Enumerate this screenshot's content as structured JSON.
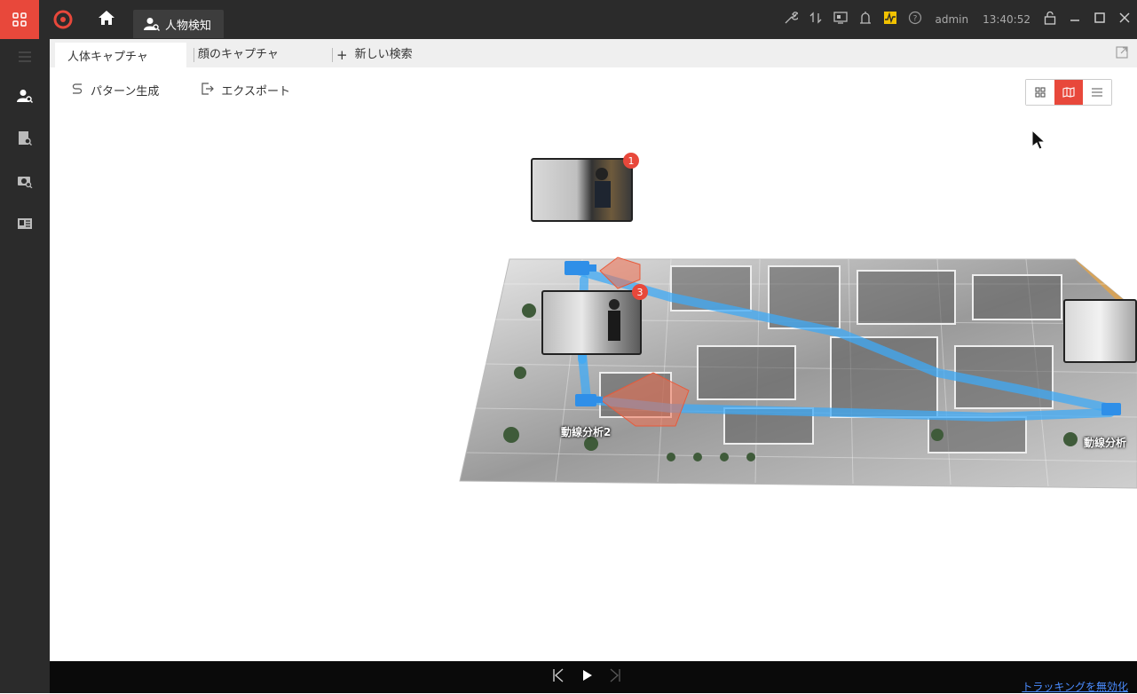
{
  "titlebar": {
    "module_tab": "人物検知",
    "right_icons": [
      "wrench-icon",
      "transfer-icon",
      "monitor-icon",
      "alarm-icon",
      "activity-icon",
      "help-icon"
    ],
    "user": "admin",
    "time": "13:40:52"
  },
  "sidebar": {
    "items": [
      "person-search-icon",
      "doc-search-icon",
      "camera-search-icon",
      "id-card-icon"
    ]
  },
  "subtabs": {
    "tabs": [
      "人体キャプチャ",
      "顔のキャプチャ",
      "新しい検索"
    ],
    "new_prefix": "+"
  },
  "toolbar": {
    "pattern_label": "パターン生成",
    "export_label": "エクスポート"
  },
  "view_switch": {
    "active": "map",
    "options": [
      "grid",
      "map",
      "list"
    ]
  },
  "map": {
    "snapshots": [
      {
        "badge": "1"
      },
      {
        "badge": "3"
      },
      {
        "badge": ""
      }
    ],
    "labels": [
      "動線分析2",
      "動線分析"
    ]
  },
  "playback": {
    "tracking_link": "トラッキングを無効化"
  },
  "colors": {
    "accent": "#e8483b",
    "path": "#3fa9f5",
    "camera": "#2f8fe8",
    "link": "#4a8cff"
  }
}
